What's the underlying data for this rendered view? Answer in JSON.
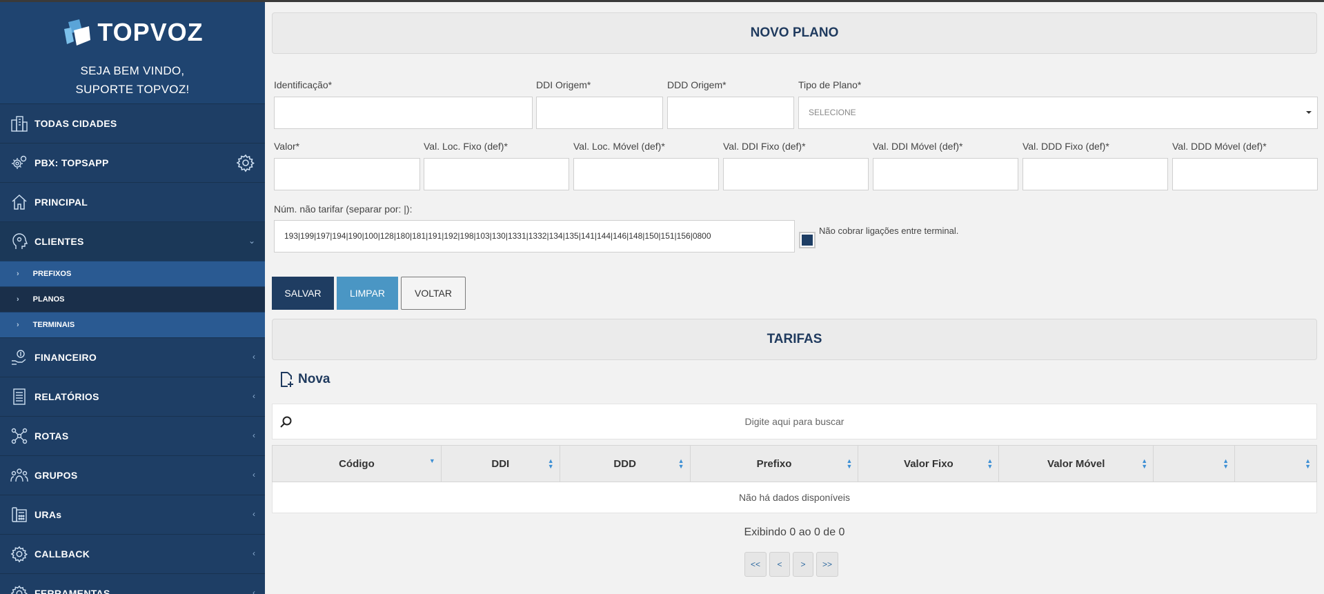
{
  "brand": {
    "name": "TOPVOZ",
    "welcome_line1": "SEJA BEM VINDO,",
    "welcome_line2": "SUPORTE TOPVOZ!"
  },
  "sidebar": {
    "items": [
      {
        "label": "TODAS CIDADES",
        "icon": "city-icon"
      },
      {
        "label": "PBX: TOPSAPP",
        "icon": "gears-icon"
      },
      {
        "label": "PRINCIPAL",
        "icon": "home-icon"
      },
      {
        "label": "CLIENTES",
        "icon": "head-gear-icon"
      },
      {
        "label": "FINANCEIRO",
        "icon": "money-hand-icon"
      },
      {
        "label": "RELATÓRIOS",
        "icon": "report-icon"
      },
      {
        "label": "ROTAS",
        "icon": "routes-icon"
      },
      {
        "label": "GRUPOS",
        "icon": "group-icon"
      },
      {
        "label": "URAs",
        "icon": "ura-phone-icon"
      },
      {
        "label": "CALLBACK",
        "icon": "gear-icon"
      },
      {
        "label": "FERRAMENTAS",
        "icon": "tools-icon"
      }
    ],
    "sub_items": [
      {
        "label": "PREFIXOS"
      },
      {
        "label": "PLANOS"
      },
      {
        "label": "TERMINAIS"
      }
    ]
  },
  "form": {
    "title": "NOVO PLANO",
    "labels": {
      "identificacao": "Identificação*",
      "ddi_origem": "DDI Origem*",
      "ddd_origem": "DDD Origem*",
      "tipo_plano": "Tipo de Plano*",
      "valor": "Valor*",
      "val_loc_fixo": "Val. Loc. Fixo (def)*",
      "val_loc_movel": "Val. Loc. Móvel (def)*",
      "val_ddi_fixo": "Val. DDI Fixo (def)*",
      "val_ddi_movel": "Val. DDI Móvel (def)*",
      "val_ddd_fixo": "Val. DDD Fixo (def)*",
      "val_ddd_movel": "Val. DDD Móvel (def)*",
      "num_nao_tarifar": "Núm. não tarifar (separar por: |):",
      "nao_cobrar": "Não cobrar ligações entre terminal."
    },
    "tipo_plano_value": "SELECIONE",
    "num_nao_tarifar_value": "193|199|197|194|190|100|128|180|181|191|192|198|103|130|1331|1332|134|135|141|144|146|148|150|151|156|0800",
    "nao_cobrar_checked": true,
    "buttons": {
      "save": "SALVAR",
      "clear": "LIMPAR",
      "back": "VOLTAR"
    }
  },
  "tarifas": {
    "title": "TARIFAS",
    "new_label": "Nova",
    "search_placeholder": "Digite aqui para buscar",
    "columns": [
      "Código",
      "DDI",
      "DDD",
      "Prefixo",
      "Valor Fixo",
      "Valor Móvel",
      "",
      ""
    ],
    "empty_text": "Não há dados disponíveis",
    "paging_info": "Exibindo 0 ao 0 de 0",
    "pager": [
      "<<",
      "<",
      ">",
      ">>"
    ]
  }
}
